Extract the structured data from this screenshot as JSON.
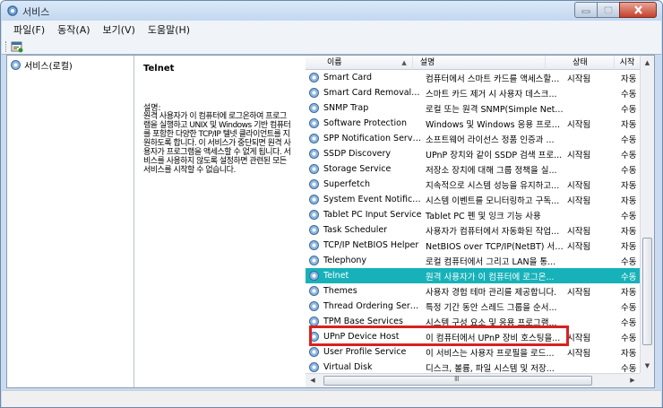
{
  "window": {
    "title": "서비스"
  },
  "menu": [
    "파일(F)",
    "동작(A)",
    "보기(V)",
    "도움말(H)"
  ],
  "tree": {
    "root_label": "서비스(로컬)"
  },
  "details": {
    "service_name": "Telnet",
    "description_label": "설명:",
    "description": "원격 사용자가 이 컴퓨터에 로그온하여 프로그램을 실행하고 UNIX 및 Windows 기반 컴퓨터를 포함한 다양한 TCP/IP 텔넷 클라이언트를 지원하도록 합니다. 이 서비스가 중단되면 원격 사용자가 프로그램을 액세스할 수 없게 됩니다. 서비스를 사용하지 않도록 설정하면 관련된 모든 서비스를 시작할 수 없습니다."
  },
  "columns": {
    "name": "이름",
    "description": "설명",
    "status": "상태",
    "startup": "시작"
  },
  "services": [
    {
      "name": "Smart Card",
      "description": "컴퓨터에서 스마트 카드를 액세스할...",
      "status": "시작됨",
      "startup": "자동"
    },
    {
      "name": "Smart Card Removal P...",
      "description": "스마트 카드 제거 시 사용자 데스크...",
      "status": "",
      "startup": "수동"
    },
    {
      "name": "SNMP Trap",
      "description": "로컬 또는 원격 SNMP(Simple Net...",
      "status": "",
      "startup": "수동"
    },
    {
      "name": "Software Protection",
      "description": "Windows 및 Windows 응용 프로그...",
      "status": "시작됨",
      "startup": "자동"
    },
    {
      "name": "SPP Notification Service",
      "description": "소프트웨어 라이선스 정품 인증과 ...",
      "status": "",
      "startup": "수동"
    },
    {
      "name": "SSDP Discovery",
      "description": "UPnP 장치와 같이 SSDP 검색 프로...",
      "status": "시작됨",
      "startup": "수동"
    },
    {
      "name": "Storage Service",
      "description": "저장소 장치에 대해 그룹 정책을 실...",
      "status": "",
      "startup": "수동"
    },
    {
      "name": "Superfetch",
      "description": "지속적으로 시스템 성능을 유지하고...",
      "status": "시작됨",
      "startup": "자동"
    },
    {
      "name": "System Event Notificati...",
      "description": "시스템 이벤트를 모니터링하고 구독...",
      "status": "시작됨",
      "startup": "자동"
    },
    {
      "name": "Tablet PC Input Service",
      "description": "Tablet PC 펜 및 잉크 기능 사용",
      "status": "",
      "startup": "수동"
    },
    {
      "name": "Task Scheduler",
      "description": "사용자가 컴퓨터에서 자동화된 작업...",
      "status": "시작됨",
      "startup": "자동"
    },
    {
      "name": "TCP/IP NetBIOS Helper",
      "description": "NetBIOS over TCP/IP(NetBT) 서비...",
      "status": "시작됨",
      "startup": "자동"
    },
    {
      "name": "Telephony",
      "description": "로컬 컴퓨터에서 그리고 LAN을 통...",
      "status": "",
      "startup": "수동"
    },
    {
      "name": "Telnet",
      "description": "원격 사용자가 이 컴퓨터에 로그온...",
      "status": "",
      "startup": "수동",
      "selected": true
    },
    {
      "name": "Themes",
      "description": "사용자 경험 테마 관리를 제공합니다.",
      "status": "시작됨",
      "startup": "자동"
    },
    {
      "name": "Thread Ordering Server",
      "description": "특정 기간 동안 스레드 그룹을 순서...",
      "status": "",
      "startup": "수동"
    },
    {
      "name": "TPM Base Services",
      "description": "시스템 구성 요소 및 응용 프로그램...",
      "status": "",
      "startup": "수동"
    },
    {
      "name": "UPnP Device Host",
      "description": "이 컴퓨터에서 UPnP 장비 호스팅을...",
      "status": "시작됨",
      "startup": "수동"
    },
    {
      "name": "User Profile Service",
      "description": "이 서비스는 사용자 프로필을 로드...",
      "status": "시작됨",
      "startup": "자동"
    },
    {
      "name": "Virtual Disk",
      "description": "디스크, 볼륨, 파일 시스템 및 저장...",
      "status": "",
      "startup": "수동"
    }
  ],
  "colors": {
    "selection": "#17b2b9",
    "highlight_border": "#d9211f"
  },
  "icons": [
    "services-app-icon",
    "toolbar-properties-icon",
    "service-gear-icon"
  ]
}
